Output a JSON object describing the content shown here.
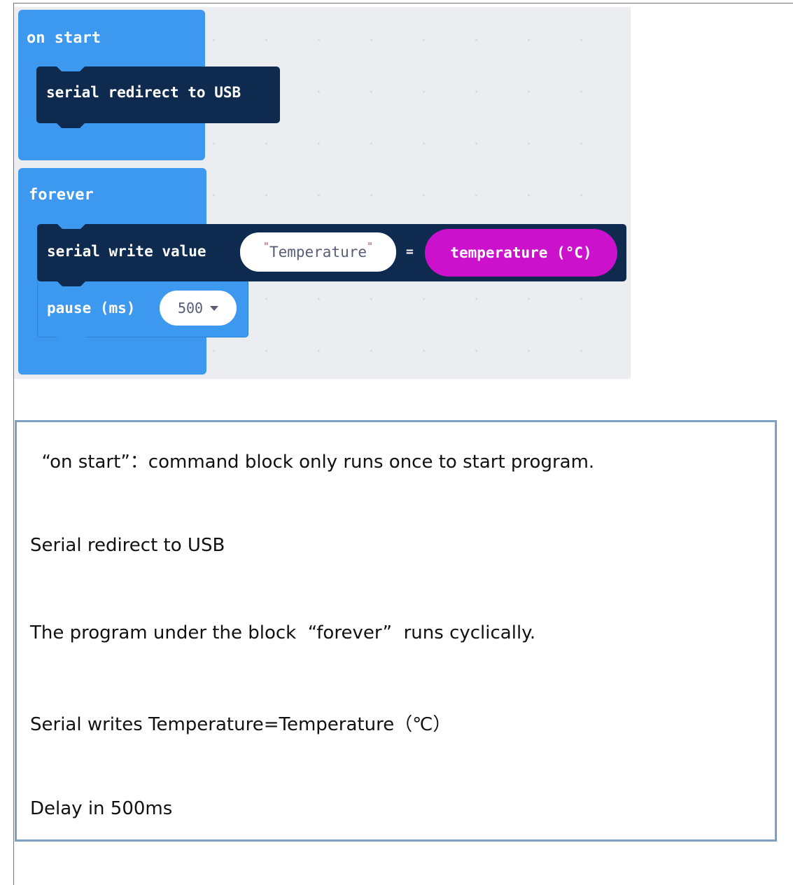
{
  "blocks": {
    "on_start": {
      "title": "on start",
      "statement": "serial redirect to USB"
    },
    "forever": {
      "title": "forever",
      "serial_write": {
        "label": "serial write value",
        "name_value": "Temperature",
        "equals": "=",
        "value_reporter": "temperature (°C)"
      },
      "pause": {
        "label": "pause (ms)",
        "value": "500"
      }
    }
  },
  "colors": {
    "event_blue": "#3d98f0",
    "serial_dark": "#0e2a4f",
    "temperature_magenta": "#cc11cc",
    "workspace_bg": "#ecedf0",
    "box_border": "#7f9fc3"
  },
  "description": {
    "lines": [
      "  “on start”：command block only runs once to start program.",
      "Serial redirect to USB",
      "The program under the block  “forever”  runs cyclically.",
      "Serial writes Temperature=Temperature（℃）",
      "Delay in 500ms"
    ]
  }
}
